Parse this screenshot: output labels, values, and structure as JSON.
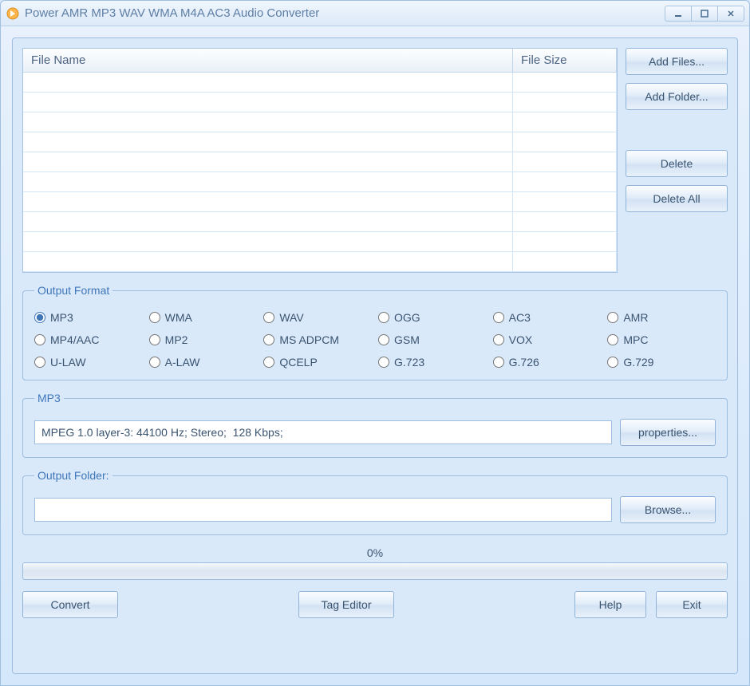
{
  "window": {
    "title": "Power AMR MP3 WAV WMA M4A AC3 Audio Converter"
  },
  "filelist": {
    "columns": {
      "name": "File Name",
      "size": "File Size"
    },
    "rows": [
      "",
      "",
      "",
      "",
      "",
      "",
      "",
      "",
      "",
      ""
    ]
  },
  "side_buttons": {
    "add_files": "Add Files...",
    "add_folder": "Add Folder...",
    "delete": "Delete",
    "delete_all": "Delete All"
  },
  "output_format": {
    "legend": "Output Format",
    "selected": "MP3",
    "options": [
      "MP3",
      "WMA",
      "WAV",
      "OGG",
      "AC3",
      "AMR",
      "MP4/AAC",
      "MP2",
      "MS ADPCM",
      "GSM",
      "VOX",
      "MPC",
      "U-LAW",
      "A-LAW",
      "QCELP",
      "G.723",
      "G.726",
      "G.729"
    ]
  },
  "format_details": {
    "legend": "MP3",
    "value": "MPEG 1.0 layer-3: 44100 Hz; Stereo;  128 Kbps;",
    "properties_btn": "properties..."
  },
  "output_folder": {
    "legend": "Output Folder:",
    "value": "",
    "browse_btn": "Browse..."
  },
  "progress": {
    "label": "0%",
    "value": 0
  },
  "bottom": {
    "convert": "Convert",
    "tag_editor": "Tag Editor",
    "help": "Help",
    "exit": "Exit"
  }
}
